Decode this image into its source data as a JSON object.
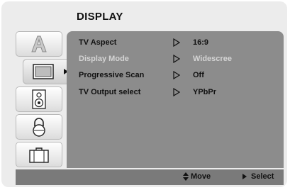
{
  "menu": {
    "title": "DISPLAY"
  },
  "tabs": [
    {
      "icon": "letter-a-icon"
    },
    {
      "icon": "tv-screen-icon",
      "active": true
    },
    {
      "icon": "speaker-icon"
    },
    {
      "icon": "lock-icon"
    },
    {
      "icon": "briefcase-icon"
    }
  ],
  "settings": [
    {
      "label": "TV Aspect",
      "value": "16:9",
      "enabled": true
    },
    {
      "label": "Display Mode",
      "value": "Widescree",
      "enabled": false
    },
    {
      "label": "Progressive Scan",
      "value": "Off",
      "enabled": true
    },
    {
      "label": "TV Output select",
      "value": "YPbPr",
      "enabled": true
    }
  ],
  "footer": {
    "move_label": "Move",
    "select_label": "Select"
  },
  "colors": {
    "panel": "#8c8c8c",
    "footer": "#7a7a7a",
    "disabled_text": "#d4d4d4",
    "background": "#ececec"
  }
}
